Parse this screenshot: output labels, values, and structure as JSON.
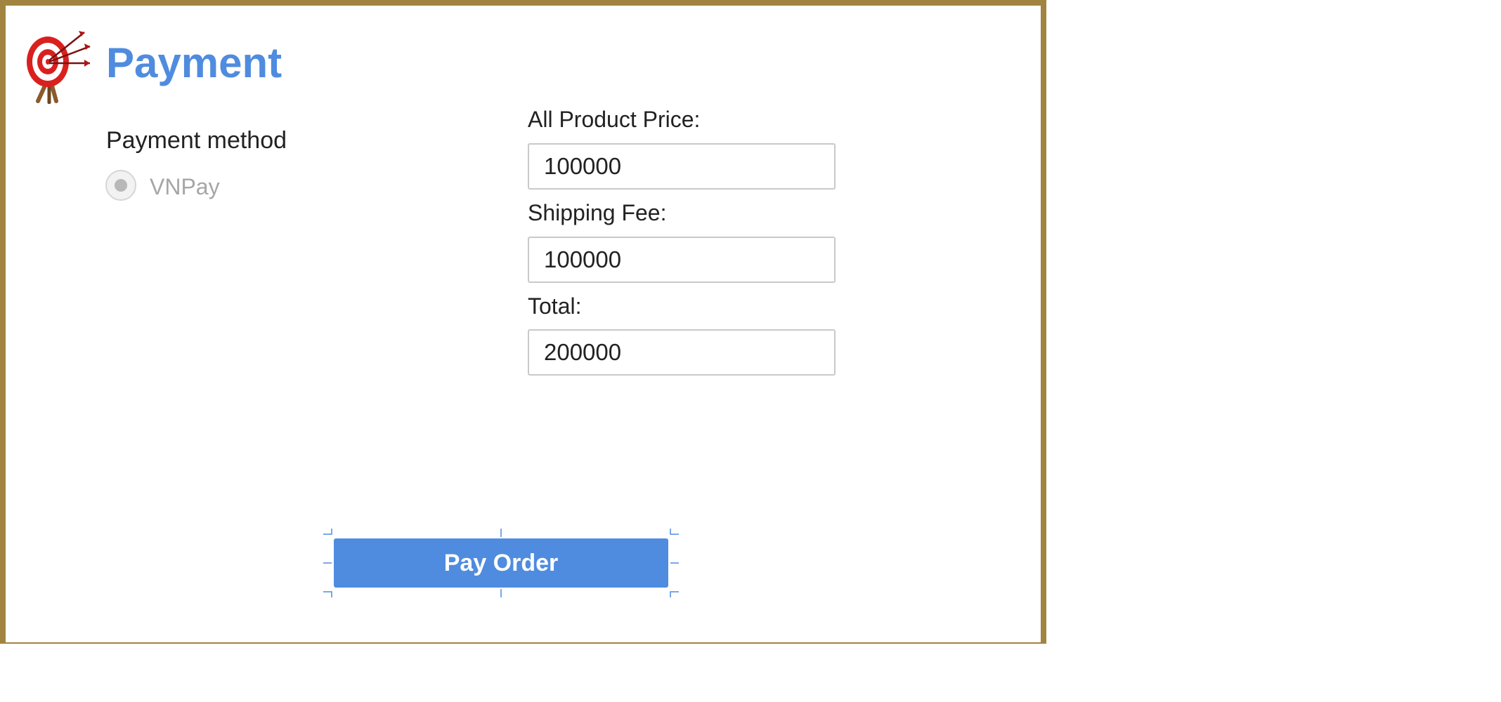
{
  "page": {
    "title": "Payment",
    "logo_icon": "target-with-arrows-icon"
  },
  "payment_method": {
    "label": "Payment method",
    "options": [
      {
        "label": "VNPay",
        "selected": true,
        "enabled": false
      }
    ]
  },
  "fields": {
    "product_price": {
      "label": "All Product Price:",
      "value": "100000"
    },
    "shipping_fee": {
      "label": "Shipping Fee:",
      "value": "100000"
    },
    "total": {
      "label": "Total:",
      "value": "200000"
    }
  },
  "actions": {
    "pay_order_label": "Pay Order"
  },
  "colors": {
    "accent": "#4f8cdf",
    "window_border": "#a08440",
    "target_red": "#d9201e"
  }
}
